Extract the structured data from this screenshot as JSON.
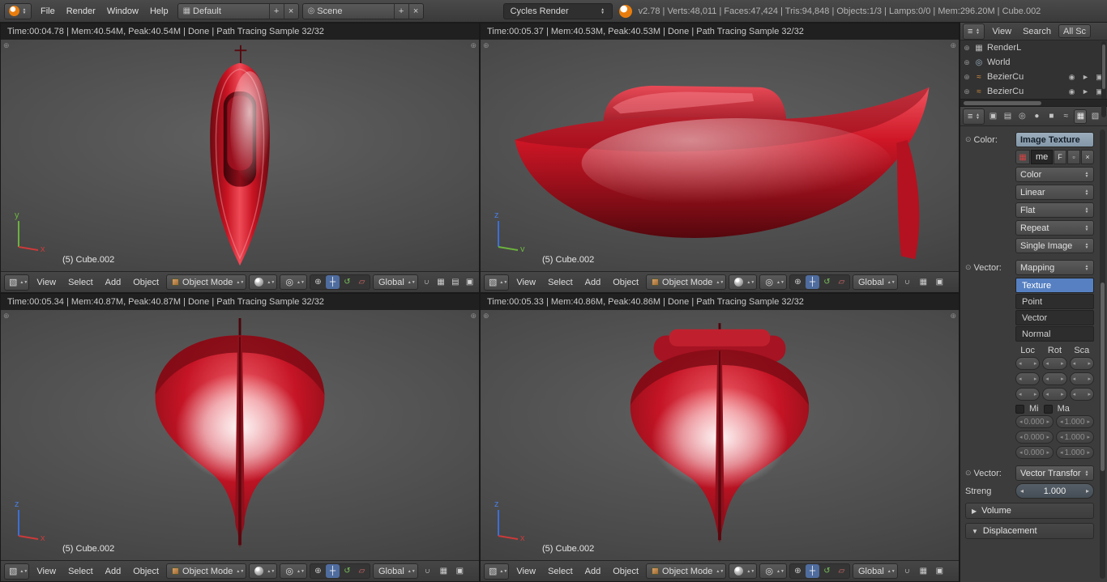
{
  "topbar": {
    "menus": [
      "File",
      "Render",
      "Window",
      "Help"
    ],
    "layout": {
      "value": "Default"
    },
    "scene": {
      "value": "Scene"
    },
    "engine": {
      "value": "Cycles Render"
    },
    "stats": "v2.78 | Verts:48,011 | Faces:47,424 | Tris:94,848 | Objects:1/3 | Lamps:0/0 | Mem:296.20M | Cube.002"
  },
  "viewport_header": {
    "menus": {
      "view": "View",
      "select": "Select",
      "add": "Add",
      "object": "Object"
    },
    "mode": "Object Mode",
    "orientation": "Global"
  },
  "viewports": [
    {
      "info": "Time:00:04.78 | Mem:40.54M, Peak:40.54M | Done | Path Tracing Sample 32/32",
      "label": "(5) Cube.002",
      "axis": {
        "v": "y",
        "h": "x"
      }
    },
    {
      "info": "Time:00:05.37 | Mem:40.53M, Peak:40.53M | Done | Path Tracing Sample 32/32",
      "label": "(5) Cube.002",
      "axis": {
        "v": "z",
        "h": "y"
      }
    },
    {
      "info": "Time:00:05.34 | Mem:40.87M, Peak:40.87M | Done | Path Tracing Sample 32/32",
      "label": "(5) Cube.002",
      "axis": {
        "v": "z",
        "h": "x"
      }
    },
    {
      "info": "Time:00:05.33 | Mem:40.86M, Peak:40.86M | Done | Path Tracing Sample 32/32",
      "label": "(5) Cube.002",
      "axis": {
        "v": "z",
        "h": "x"
      }
    }
  ],
  "outliner": {
    "tabs": [
      "View",
      "Search",
      "All Sc"
    ],
    "items": [
      {
        "label": "RenderL"
      },
      {
        "label": "World"
      },
      {
        "label": "BezierCu"
      },
      {
        "label": "BezierCu"
      }
    ]
  },
  "properties": {
    "color_label": "Color:",
    "color_value": "Image Texture",
    "image_name": "me",
    "fake_user": "F",
    "dropdowns": [
      "Color",
      "Linear",
      "Flat",
      "Repeat",
      "Single Image"
    ],
    "vector_label": "Vector:",
    "mapping_value": "Mapping",
    "mapping_modes": [
      "Texture",
      "Point",
      "Vector",
      "Normal"
    ],
    "axis_columns": [
      "Loc",
      "Rot",
      "Sca"
    ],
    "min_label": "Mi",
    "max_label": "Ma",
    "min_value": "0.000",
    "max_value": "1.000",
    "vector2_label": "Vector:",
    "vector2_value": "Vector Transfor",
    "strength_label": "Streng",
    "strength_value": "1.000",
    "panels": {
      "volume": "Volume",
      "displacement": "Displacement"
    }
  },
  "icons": {
    "updown": "▲▼",
    "plus": "+",
    "close": "×",
    "screen": "▦",
    "scene_badge": "◎",
    "editor_3d": "▧",
    "editor_outliner": "≡",
    "editor_props": "≡",
    "pivot": "◎",
    "cursor_tool": "⊕",
    "translate": "┼",
    "rotate": "↺",
    "scale": "▱",
    "magnet": "∩",
    "snap_grid": "▦",
    "camera_render": "▣",
    "layers": "▤",
    "dot": "⊕",
    "eye": "◉",
    "arrow": "►",
    "camera": "▣",
    "world": "◎",
    "render_layer": "▦",
    "curve": "≈",
    "socket": "⊙",
    "left": "◂",
    "right": "▸",
    "collapsed": "▶",
    "expanded": "▼",
    "image": "▦",
    "file_new": "▫",
    "props_tabs": [
      "▣",
      "▤",
      "◎",
      "●",
      "■",
      "≈",
      "▦",
      "▧"
    ]
  },
  "colors": {
    "accent_blue": "#5680c2",
    "boat_red": "#c3101f",
    "blender_orange": "#e87d0d",
    "axis_x": "#cc3a3a",
    "axis_y": "#6cb23e",
    "axis_z": "#3a6fd8"
  }
}
